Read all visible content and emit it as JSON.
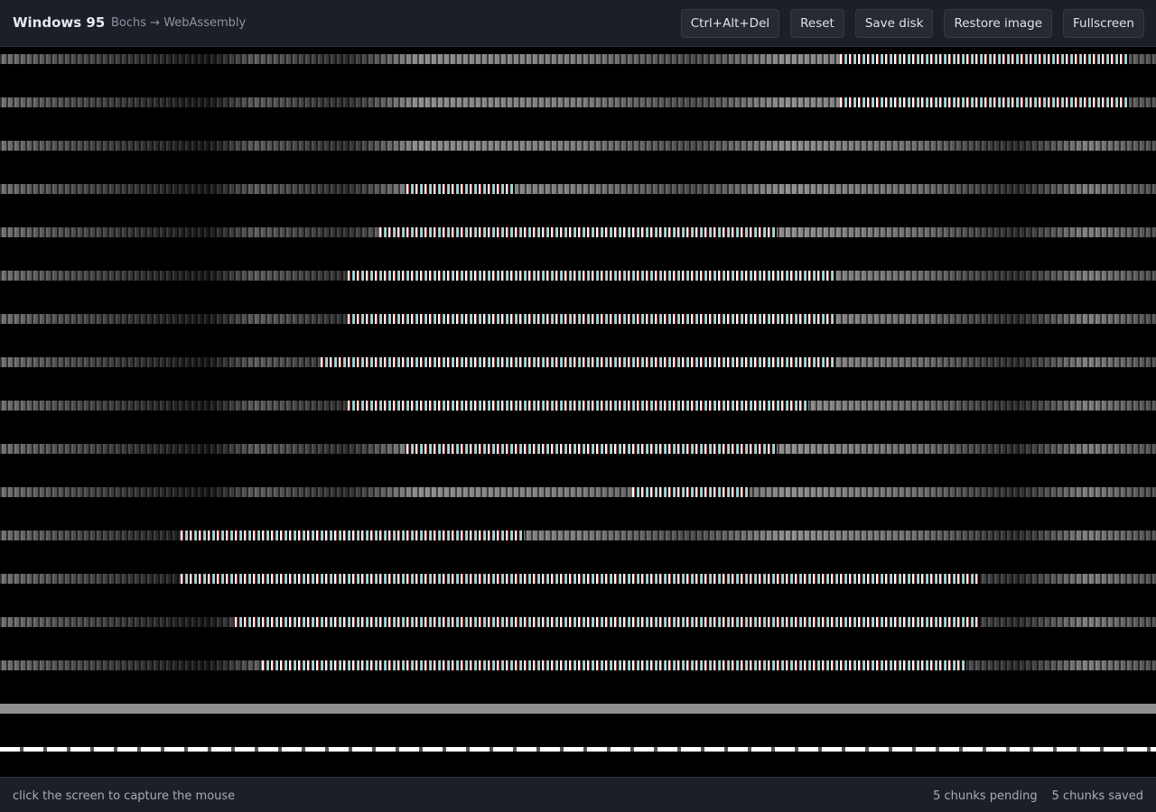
{
  "header": {
    "title": "Windows 95",
    "subtitle": "Bochs → WebAssembly"
  },
  "toolbar": {
    "buttons": [
      {
        "label": "Ctrl+Alt+Del"
      },
      {
        "label": "Reset"
      },
      {
        "label": "Save disk"
      },
      {
        "label": "Restore image"
      },
      {
        "label": "Fullscreen"
      }
    ]
  },
  "status": {
    "hint": "click the screen to capture the mouse",
    "pending": "5 chunks pending",
    "saved": "5 chunks saved"
  },
  "colors": {
    "bar_background": "#1b1f26",
    "screen_background": "#000000",
    "button_background": "#252a33",
    "text_primary": "#e6e9ee",
    "text_muted": "#8b94a2"
  }
}
